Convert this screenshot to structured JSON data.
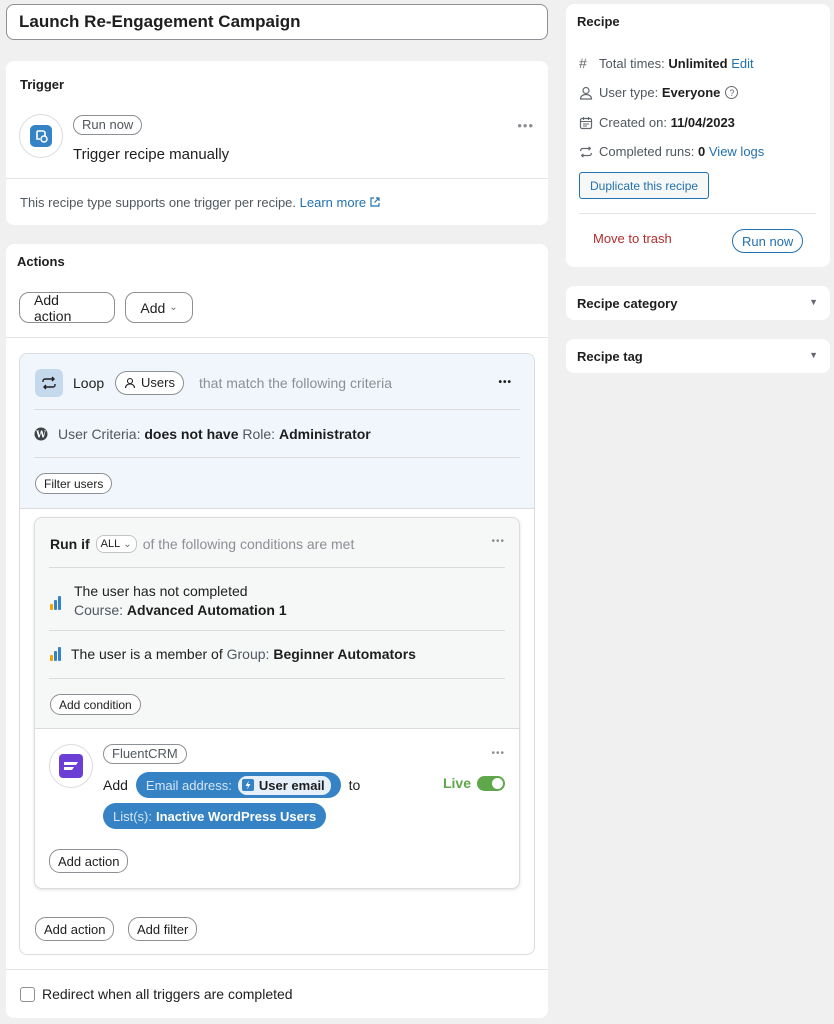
{
  "title": "Launch Re-Engagement Campaign",
  "trigger": {
    "heading": "Trigger",
    "badge": "Run now",
    "name": "Trigger recipe manually",
    "note": "This recipe type supports one trigger per recipe.",
    "learn_more": "Learn more"
  },
  "actions": {
    "heading": "Actions",
    "add_action": "Add action",
    "add": "Add",
    "loop": {
      "label": "Loop",
      "target": "Users",
      "criteria_text": "that match the following criteria",
      "criteria": {
        "prefix": "User Criteria:",
        "operator": "does not have",
        "field": "Role:",
        "value": "Administrator"
      },
      "filter_users": "Filter users"
    },
    "condition_block": {
      "run_if": "Run if",
      "mode": "ALL",
      "suffix": "of the following conditions are met",
      "conditions": [
        {
          "line1": "The user has not completed",
          "field": "Course:",
          "value": "Advanced Automation 1"
        },
        {
          "line1": "The user is a member of",
          "field": "Group:",
          "value": "Beginner Automators"
        }
      ],
      "add_condition": "Add condition"
    },
    "fluent": {
      "integration": "FluentCRM",
      "verb": "Add",
      "email_label": "Email address:",
      "email_value": "User email",
      "connector": "to",
      "list_label": "List(s):",
      "list_value": "Inactive WordPress Users",
      "status": "Live",
      "add_action": "Add action"
    },
    "loop_add_action": "Add action",
    "loop_add_filter": "Add filter",
    "redirect_label": "Redirect when all triggers are completed"
  },
  "recipe": {
    "heading": "Recipe",
    "total_times_label": "Total times:",
    "total_times_value": "Unlimited",
    "edit": "Edit",
    "user_type_label": "User type:",
    "user_type_value": "Everyone",
    "created_label": "Created on:",
    "created_value": "11/04/2023",
    "runs_label": "Completed runs:",
    "runs_value": "0",
    "view_logs": "View logs",
    "duplicate": "Duplicate this recipe",
    "trash": "Move to trash",
    "run_now": "Run now"
  },
  "category": {
    "heading": "Recipe category"
  },
  "tag": {
    "heading": "Recipe tag"
  },
  "colors": {
    "accent": "#2271b1",
    "danger": "#b32d2e",
    "live": "#5ea74a",
    "token": "#3582c4"
  }
}
